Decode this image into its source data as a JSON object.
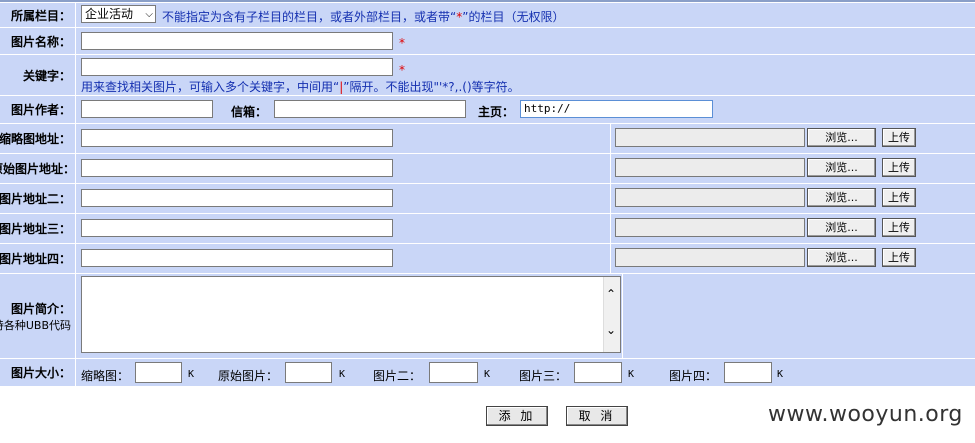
{
  "form": {
    "category": {
      "label": "所属栏目：",
      "selected": "企业活动",
      "hint_pre": "不能指定为含有子栏目的栏目，或者外部栏目，或者带“",
      "hint_mark": "*",
      "hint_post": "”的栏目（无权限）"
    },
    "name": {
      "label": "图片名称：",
      "value": "",
      "required_mark": "*"
    },
    "keywords": {
      "label": "关键字：",
      "value": "",
      "required_mark": "*",
      "hint_pre": "用来查找相关图片，可输入多个关键字，中间用“",
      "hint_mark": "|",
      "hint_post": "”隔开。不能出现\"'*?,.()等字符。"
    },
    "author": {
      "label": "图片作者：",
      "value": "",
      "email_label": "信箱：",
      "email_value": "",
      "homepage_label": "主页：",
      "homepage_value": "http://"
    },
    "urls": [
      {
        "label": "缩略图地址：",
        "value": "",
        "browse": "浏览...",
        "upload": "上传"
      },
      {
        "label": "原始图片地址：",
        "value": "",
        "browse": "浏览...",
        "upload": "上传"
      },
      {
        "label": "图片地址二：",
        "value": "",
        "browse": "浏览...",
        "upload": "上传"
      },
      {
        "label": "图片地址三：",
        "value": "",
        "browse": "浏览...",
        "upload": "上传"
      },
      {
        "label": "图片地址四：",
        "value": "",
        "browse": "浏览...",
        "upload": "上传"
      }
    ],
    "intro": {
      "label": "图片简介：",
      "sublabel": "持各种UBB代码",
      "value": "",
      "scroll_up": "⌃",
      "scroll_down": "⌄"
    },
    "sizes": {
      "label": "图片大小：",
      "unit": "K",
      "fields": [
        {
          "label": "缩略图：",
          "value": ""
        },
        {
          "label": "原始图片：",
          "value": ""
        },
        {
          "label": "图片二：",
          "value": ""
        },
        {
          "label": "图片三：",
          "value": ""
        },
        {
          "label": "图片四：",
          "value": ""
        }
      ]
    }
  },
  "actions": {
    "submit": "添 加",
    "cancel": "取 消"
  },
  "watermark": "www.wooyun.org"
}
